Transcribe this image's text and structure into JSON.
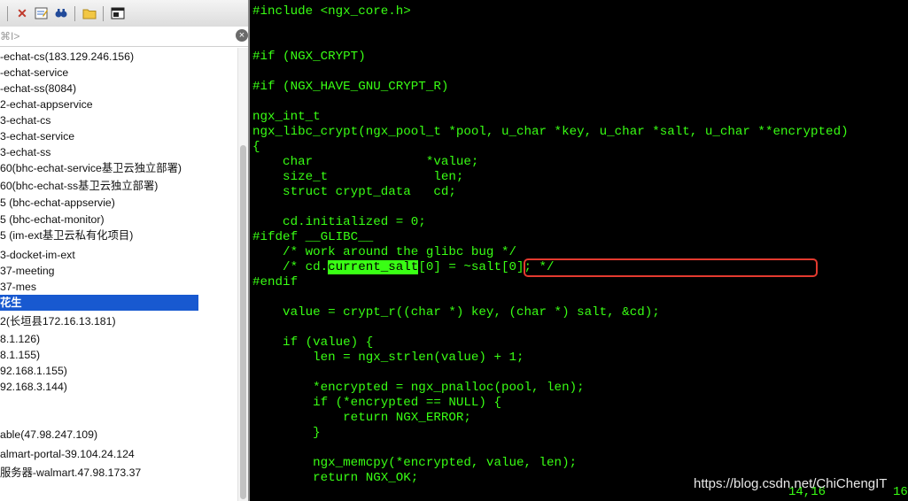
{
  "filter": {
    "placeholder": "⌘I>"
  },
  "hosts": [
    "-echat-cs(183.129.246.156)",
    "-echat-service",
    "-echat-ss(8084)",
    "2-echat-appservice",
    "3-echat-cs",
    "3-echat-service",
    "3-echat-ss",
    "60(bhc-echat-service基卫云独立部署)",
    "60(bhc-echat-ss基卫云独立部署)",
    "5 (bhc-echat-appservie)",
    "5 (bhc-echat-monitor)",
    "5 (im-ext基卫云私有化项目)",
    "3-docket-im-ext",
    "37-meeting",
    "37-mes",
    "花生",
    "2(长垣县172.16.13.181)",
    "8.1.126)",
    "8.1.155)",
    " 92.168.1.155)",
    "92.168.3.144)",
    "",
    "",
    "able(47.98.247.109)",
    "almart-portal-39.104.24.124",
    "服务器-walmart.47.98.173.37"
  ],
  "selected_index": 15,
  "code": [
    "#include <ngx_core.h>",
    "",
    "",
    "#if (NGX_CRYPT)",
    "",
    "#if (NGX_HAVE_GNU_CRYPT_R)",
    "",
    "ngx_int_t",
    "ngx_libc_crypt(ngx_pool_t *pool, u_char *key, u_char *salt, u_char **encrypted)",
    "{",
    "    char               *value;",
    "    size_t              len;",
    "    struct crypt_data   cd;",
    "",
    "    cd.initialized = 0;",
    "#ifdef __GLIBC__",
    "    /* work around the glibc bug */",
    "    /* cd.current_salt[0] = ~salt[0]; */",
    "#endif",
    "",
    "    value = crypt_r((char *) key, (char *) salt, &cd);",
    "",
    "    if (value) {",
    "        len = ngx_strlen(value) + 1;",
    "",
    "        *encrypted = ngx_pnalloc(pool, len);",
    "        if (*encrypted == NULL) {",
    "            return NGX_ERROR;",
    "        }",
    "",
    "        ngx_memcpy(*encrypted, value, len);",
    "        return NGX_OK;"
  ],
  "highlight": {
    "line": 17,
    "before": "    /* cd.",
    "match": "current_salt",
    "after": "[0] = ~salt[0]; */"
  },
  "status": {
    "cursor": "14,16",
    "scroll": "16"
  },
  "watermark": "https://blog.csdn.net/ChiChengIT",
  "colors": {
    "terminal_text": "#39ff14",
    "terminal_bg": "#000000",
    "selection": "#1859d0",
    "annotation_box": "#e33a2f"
  }
}
